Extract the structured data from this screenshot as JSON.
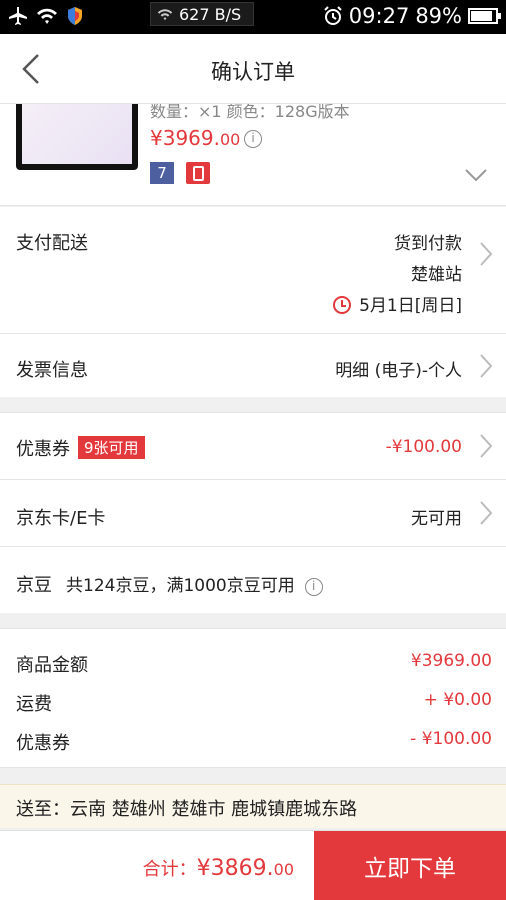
{
  "status_bar": {
    "net_speed": "627 B/S",
    "time": "09:27",
    "battery": "89%",
    "battery_level": 0.89
  },
  "header": {
    "title": "确认订单"
  },
  "product": {
    "meta": "数量：×1  颜色：128G版本",
    "price_main": "¥3969.",
    "price_cents": "00",
    "badge_text": "7"
  },
  "delivery": {
    "label": "支付配送",
    "payment": "货到付款",
    "station": "楚雄站",
    "date": "5月1日[周日]"
  },
  "invoice": {
    "label": "发票信息",
    "value": "明细 (电子)-个人"
  },
  "coupon": {
    "label": "优惠券",
    "tag": "9张可用",
    "value": "-¥100.00"
  },
  "jdcard": {
    "label": "京东卡/E卡",
    "value": "无可用"
  },
  "jingdou": {
    "label": "京豆",
    "text": "共124京豆，满1000京豆可用"
  },
  "summary": {
    "goods_label": "商品金额",
    "goods_value": "¥3969.00",
    "shipping_label": "运费",
    "shipping_value": "+ ¥0.00",
    "coupon_label": "优惠券",
    "coupon_value": "- ¥100.00"
  },
  "address": {
    "text": "送至：云南 楚雄州 楚雄市 鹿城镇鹿城东路"
  },
  "bottom": {
    "total_label": "合计：",
    "total_main": "¥3869.",
    "total_cents": "00",
    "submit_label": "立即下单"
  }
}
